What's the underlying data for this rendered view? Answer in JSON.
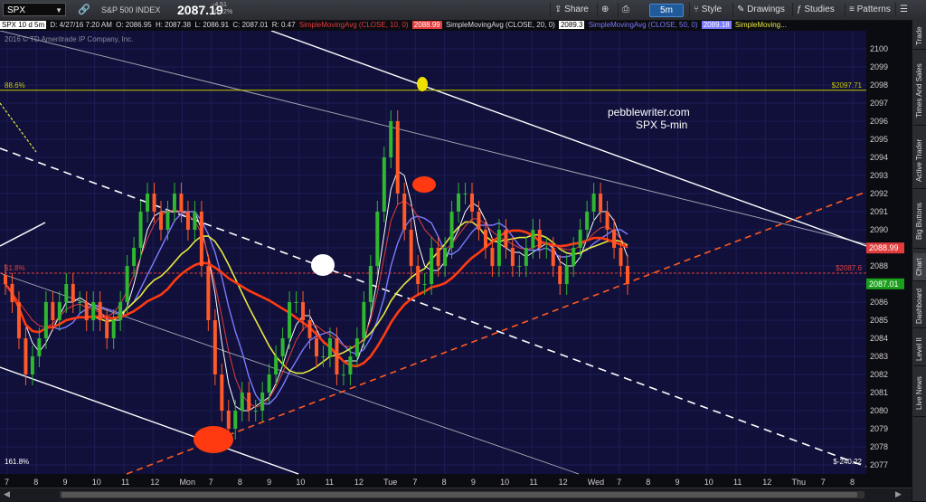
{
  "toolbar": {
    "symbol": "SPX",
    "name": "S&P 500 INDEX",
    "last": "2087.19",
    "change": "-4.51",
    "change_pct": "-0.22%",
    "share_label": "Share",
    "timeframe": "5m",
    "style_label": "Style",
    "drawings_label": "Drawings",
    "studies_label": "Studies",
    "patterns_label": "Patterns"
  },
  "infobar": {
    "desc": "SPX 10 d 5m",
    "date": "D: 4/27/16 7:20 AM",
    "open": "O: 2086.95",
    "high": "H: 2087.38",
    "low": "L: 2086.91",
    "close": "C: 2087.01",
    "r": "R: 0.47",
    "sma10_label": "SimpleMovingAvg (CLOSE, 10, 0)",
    "sma10_val": "2088.99",
    "sma20_label": "SimpleMovingAvg (CLOSE, 20, 0)",
    "sma20_val": "2089.3",
    "sma50_label": "SimpleMovingAvg (CLOSE, 50, 0)",
    "sma50_val": "2089.18",
    "sma_more": "SimpleMoving..."
  },
  "copyright": "2016 © TD Ameritrade IP Company, Inc.",
  "sidebar_tabs": [
    "Trade",
    "Times And Sales",
    "Active Trader",
    "Big Buttons",
    "Chart",
    "Dashboard",
    "Level II",
    "Live News"
  ],
  "chart_data": {
    "type": "candlestick",
    "instrument": "SPX 5-min",
    "ylim": [
      2076.5,
      2101
    ],
    "y_ticks": [
      2077,
      2078,
      2079,
      2080,
      2081,
      2082,
      2083,
      2084,
      2085,
      2086,
      2087,
      2088,
      2089,
      2090,
      2091,
      2092,
      2093,
      2094,
      2095,
      2096,
      2097,
      2098,
      2099,
      2100
    ],
    "x_labels": [
      "7",
      "8",
      "9",
      "10",
      "11",
      "12",
      "Mon",
      "7",
      "8",
      "9",
      "10",
      "11",
      "12",
      "Tue",
      "7",
      "8",
      "9",
      "10",
      "11",
      "12",
      "Wed",
      "7",
      "8",
      "9",
      "10",
      "11",
      "12",
      "Thu",
      "7",
      "8"
    ],
    "price_tags": {
      "sma10": "2088.99",
      "last": "2087.01"
    },
    "fib_levels": [
      {
        "label": "88.6%",
        "value": 2097.71,
        "tag": "$2097.71",
        "color": "#c8c800"
      },
      {
        "label": "61.8%",
        "value": 2087.6,
        "tag": "$2087.6",
        "color": "#e23c3c"
      },
      {
        "label": "161.8%",
        "value": 2076.9,
        "tag": "$-240.22",
        "color": "#ffffff"
      }
    ],
    "annotation_text": [
      "pebblewriter.com",
      "SPX 5-min"
    ],
    "close_series": [
      2087,
      2086,
      2084,
      2082,
      2083,
      2084,
      2086,
      2085,
      2086,
      2087,
      2086,
      2086,
      2085,
      2086,
      2085,
      2084,
      2085,
      2086,
      2088,
      2089,
      2091,
      2092,
      2091,
      2090,
      2091,
      2092,
      2091,
      2090,
      2091,
      2088,
      2085,
      2082,
      2080,
      2079,
      2080,
      2081,
      2080,
      2080,
      2081,
      2082,
      2083,
      2084,
      2086,
      2086,
      2085,
      2084,
      2083,
      2083,
      2084,
      2082,
      2082,
      2083,
      2084,
      2086,
      2088,
      2091,
      2094,
      2096,
      2092,
      2090,
      2088,
      2087,
      2087,
      2089,
      2088,
      2089,
      2091,
      2092,
      2092,
      2091,
      2090,
      2089,
      2088,
      2090,
      2089,
      2088,
      2088,
      2089,
      2090,
      2089,
      2089,
      2088,
      2087,
      2088,
      2089,
      2090,
      2091,
      2092,
      2091,
      2090,
      2089,
      2088,
      2087
    ],
    "sma10": [
      2087,
      2086.5,
      2086,
      2085.5,
      2085,
      2084.7,
      2084.6,
      2084.8,
      2085.2,
      2085.6,
      2085.8,
      2085.9,
      2085.7,
      2085.6,
      2085.4,
      2085.2,
      2085.4,
      2085.9,
      2086.6,
      2087.5,
      2088.5,
      2089.5,
      2090.3,
      2090.8,
      2091.0,
      2091.1,
      2091.0,
      2090.8,
      2090.5,
      2089.8,
      2088.6,
      2087.0,
      2085.2,
      2083.3,
      2081.8,
      2080.9,
      2080.4,
      2080.2,
      2080.3,
      2080.7,
      2081.3,
      2082.1,
      2083.0,
      2083.9,
      2084.5,
      2084.8,
      2084.7,
      2084.4,
      2084.2,
      2083.9,
      2083.6,
      2083.5,
      2083.6,
      2084.0,
      2085.0,
      2086.5,
      2088.5,
      2090.5,
      2091.4,
      2091.6,
      2091.3,
      2090.7,
      2090.0,
      2089.6,
      2089.2,
      2088.9,
      2089.2,
      2089.7,
      2090.2,
      2090.6,
      2090.6,
      2090.3,
      2089.9,
      2089.6,
      2089.4,
      2089.2,
      2089.0,
      2088.9,
      2089.0,
      2089.2,
      2089.3,
      2089.2,
      2089.0,
      2088.9,
      2088.9,
      2089.1,
      2089.4,
      2089.8,
      2090.1,
      2090.2,
      2089.9,
      2089.5,
      2088.99
    ]
  }
}
